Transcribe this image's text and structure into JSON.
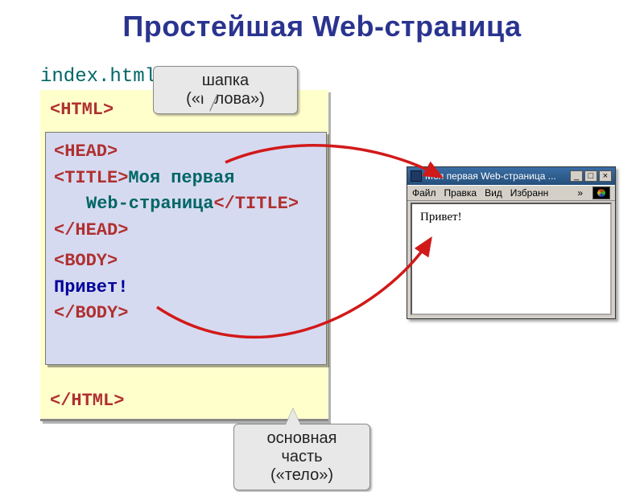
{
  "title": "Простейшая Web-страница",
  "filename": "index.html",
  "outer": {
    "open": "<HTML>",
    "close": "</HTML>"
  },
  "inner": {
    "head_open": "<HEAD>",
    "title_open": "<TITLE>",
    "title_text_line1": "Моя первая",
    "title_text_line2": "Web-страница",
    "title_close": "</TITLE>",
    "head_close": "</HEAD>",
    "body_open": "<BODY>",
    "body_text": "Привет!",
    "body_close": "</BODY>"
  },
  "callouts": {
    "head": "шапка («голова»)",
    "body_line1": "основная часть",
    "body_line2": "(«тело»)"
  },
  "browser": {
    "title": "Моя первая Web-страница ...",
    "menu": {
      "file": "Файл",
      "edit": "Правка",
      "view": "Вид",
      "fav": "Избранн",
      "chev": "»"
    },
    "content": "Привет!",
    "btn_min": "_",
    "btn_max": "□",
    "btn_close": "×"
  }
}
